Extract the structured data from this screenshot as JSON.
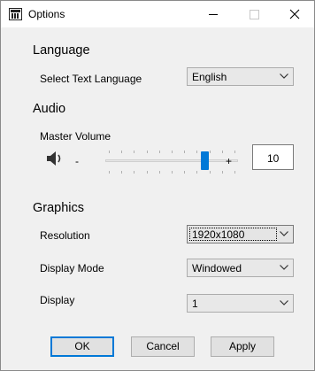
{
  "window": {
    "title": "Options"
  },
  "language": {
    "section": "Language",
    "label": "Select Text Language",
    "value": "English"
  },
  "audio": {
    "section": "Audio",
    "label": "Master Volume",
    "minus": "-",
    "plus": "+",
    "value": "10",
    "slider_fraction": 0.76
  },
  "graphics": {
    "section": "Graphics",
    "resolution": {
      "label": "Resolution",
      "value": "1920x1080"
    },
    "display_mode": {
      "label": "Display Mode",
      "value": "Windowed"
    },
    "display": {
      "label": "Display",
      "value": "1"
    }
  },
  "buttons": {
    "ok": "OK",
    "cancel": "Cancel",
    "apply": "Apply"
  },
  "colors": {
    "accent": "#0078d7",
    "background": "#f0f0f0"
  }
}
